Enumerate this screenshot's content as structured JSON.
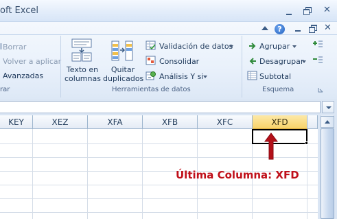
{
  "window": {
    "title": "oft Excel"
  },
  "ribbon": {
    "left_group": {
      "items": [
        {
          "label": "Borrar",
          "enabled": false
        },
        {
          "label": "Volver a aplicar",
          "enabled": false
        },
        {
          "label": "Avanzadas",
          "enabled": true
        }
      ],
      "group_label": "rar"
    },
    "tools_group": {
      "text_to_columns": "Texto en columnas",
      "text_to_columns_line1": "Texto en",
      "text_to_columns_line2": "columnas",
      "remove_duplicates_line1": "Quitar",
      "remove_duplicates_line2": "duplicados",
      "data_validation": "Validación de datos",
      "consolidate": "Consolidar",
      "what_if": "Análisis Y si",
      "group_label": "Herramientas de datos"
    },
    "outline_group": {
      "group": "Agrupar",
      "ungroup": "Desagrupar",
      "subtotal": "Subtotal",
      "group_label": "Esquema"
    }
  },
  "sheet": {
    "columns": [
      "KEY",
      "XEZ",
      "XFA",
      "XFB",
      "XFC",
      "XFD"
    ],
    "active_column": "XFD"
  },
  "annotation": {
    "text": "Última Columna: XFD",
    "color": "#c0101a"
  },
  "colors": {
    "active_header": "#f8d36a",
    "ribbon_text": "#1e395b",
    "annotation": "#c0101a"
  }
}
